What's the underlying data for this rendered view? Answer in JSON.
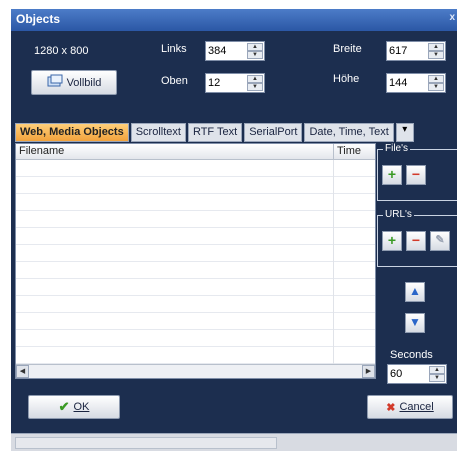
{
  "window": {
    "title": "Objects",
    "close": "x"
  },
  "resolution": "1280 x 800",
  "vollbild_label": "Vollbild",
  "fields": {
    "links": {
      "label": "Links",
      "value": "384"
    },
    "oben": {
      "label": "Oben",
      "value": "12"
    },
    "breite": {
      "label": "Breite",
      "value": "617"
    },
    "hoehe": {
      "label": "Höhe",
      "value": "144"
    }
  },
  "tabs": [
    "Web, Media Objects",
    "Scrolltext",
    "RTF Text",
    "SerialPort",
    "Date, Time, Text"
  ],
  "table": {
    "columns": [
      "Filename",
      "Time"
    ]
  },
  "groups": {
    "files": "File's",
    "urls": "URL's"
  },
  "seconds": {
    "label": "Seconds",
    "value": "60"
  },
  "buttons": {
    "ok": "OK",
    "cancel": "Cancel"
  },
  "colors": {
    "window_bg": "#1c2e4f",
    "active_tab": "#f2a23c",
    "title_bar": "#2b57a5"
  },
  "icons": [
    "vollbild-icon",
    "plus-icon",
    "minus-icon",
    "edit-icon",
    "arrow-up-icon",
    "arrow-down-icon",
    "check-icon",
    "x-icon"
  ]
}
